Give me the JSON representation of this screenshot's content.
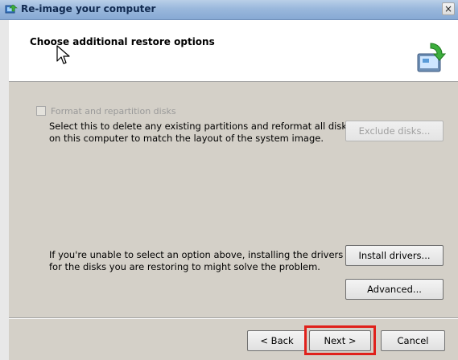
{
  "window": {
    "title": "Re-image your computer",
    "close_label": "×",
    "title_icon": "backup-restore-icon"
  },
  "header": {
    "title": "Choose additional restore options",
    "icon": "computer-restore-icon"
  },
  "format_option": {
    "label": "Format and repartition disks",
    "checked": false,
    "enabled": false,
    "description_line1": "Select this to delete any existing partitions and reformat all disks",
    "description_line2": "on this computer to match the layout of the system image.",
    "exclude_button": "Exclude disks..."
  },
  "drivers": {
    "description_line1": "If you're unable to select an option above, installing the drivers",
    "description_line2": "for the disks you are restoring to might solve the problem.",
    "install_button": "Install drivers...",
    "advanced_button": "Advanced..."
  },
  "footer": {
    "back_button": "< Back",
    "next_button": "Next >",
    "cancel_button": "Cancel"
  },
  "colors": {
    "highlight": "#e0211b",
    "titlebar": "#9ab8dc",
    "dialog_bg": "#d4d0c8"
  }
}
